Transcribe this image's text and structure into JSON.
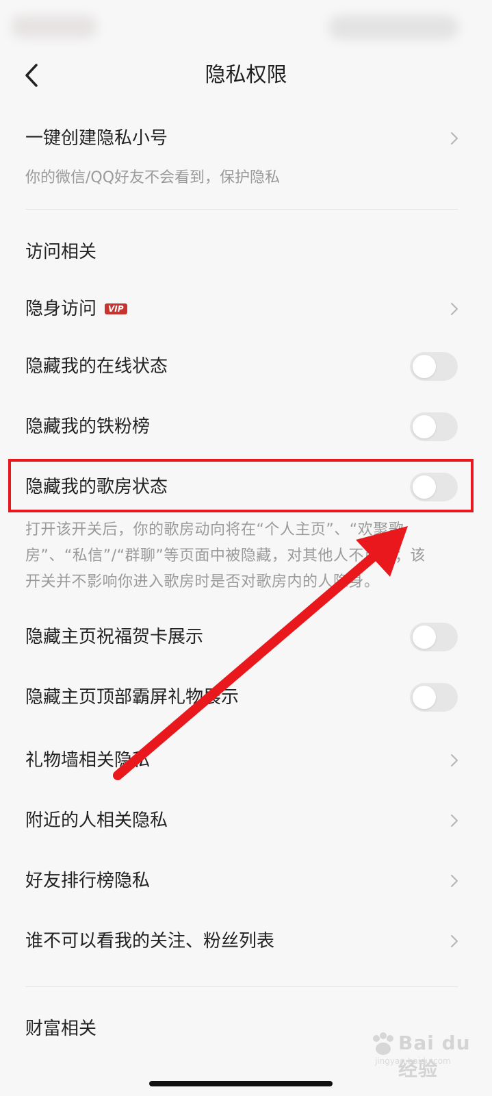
{
  "nav": {
    "title": "隐私权限"
  },
  "create_private": {
    "label": "一键创建隐私小号",
    "subtitle": "你的微信/QQ好友不会看到，保护隐私"
  },
  "section_access": {
    "title": "访问相关"
  },
  "items": [
    {
      "label": "隐身访问",
      "type": "link",
      "badge": "VIP"
    },
    {
      "label": "隐藏我的在线状态",
      "type": "toggle",
      "on": false
    },
    {
      "label": "隐藏我的铁粉榜",
      "type": "toggle",
      "on": false
    },
    {
      "label": "隐藏我的歌房状态",
      "type": "toggle",
      "on": false
    },
    {
      "label": "隐藏主页祝福贺卡展示",
      "type": "toggle",
      "on": false
    },
    {
      "label": "隐藏主页顶部霸屏礼物展示",
      "type": "toggle",
      "on": false
    },
    {
      "label": "礼物墙相关隐私",
      "type": "link"
    },
    {
      "label": "附近的人相关隐私",
      "type": "link"
    },
    {
      "label": "好友排行榜隐私",
      "type": "link"
    },
    {
      "label": "谁不可以看我的关注、粉丝列表",
      "type": "link"
    }
  ],
  "room_status_desc": {
    "line1": "打开该开关后，你的歌房动向将在“个人主页”、“欢聚歌",
    "line2": "房”、“私信”/“群聊”等页面中被隐藏，对其他人不可见；该",
    "line3": "开关并不影响你进入歌房时是否对歌房内的人隐身。"
  },
  "section_wealth": {
    "title": "财富相关"
  },
  "watermark": {
    "text": "Bai du 经验",
    "sub": "jingyan.baidu.com"
  },
  "colors": {
    "background": "#f7f7f7",
    "annotation_red": "#e8181d",
    "vip_badge": "#c8322f",
    "toggle_off": "#e6e6e6",
    "secondary_text": "#9a9a9a"
  }
}
